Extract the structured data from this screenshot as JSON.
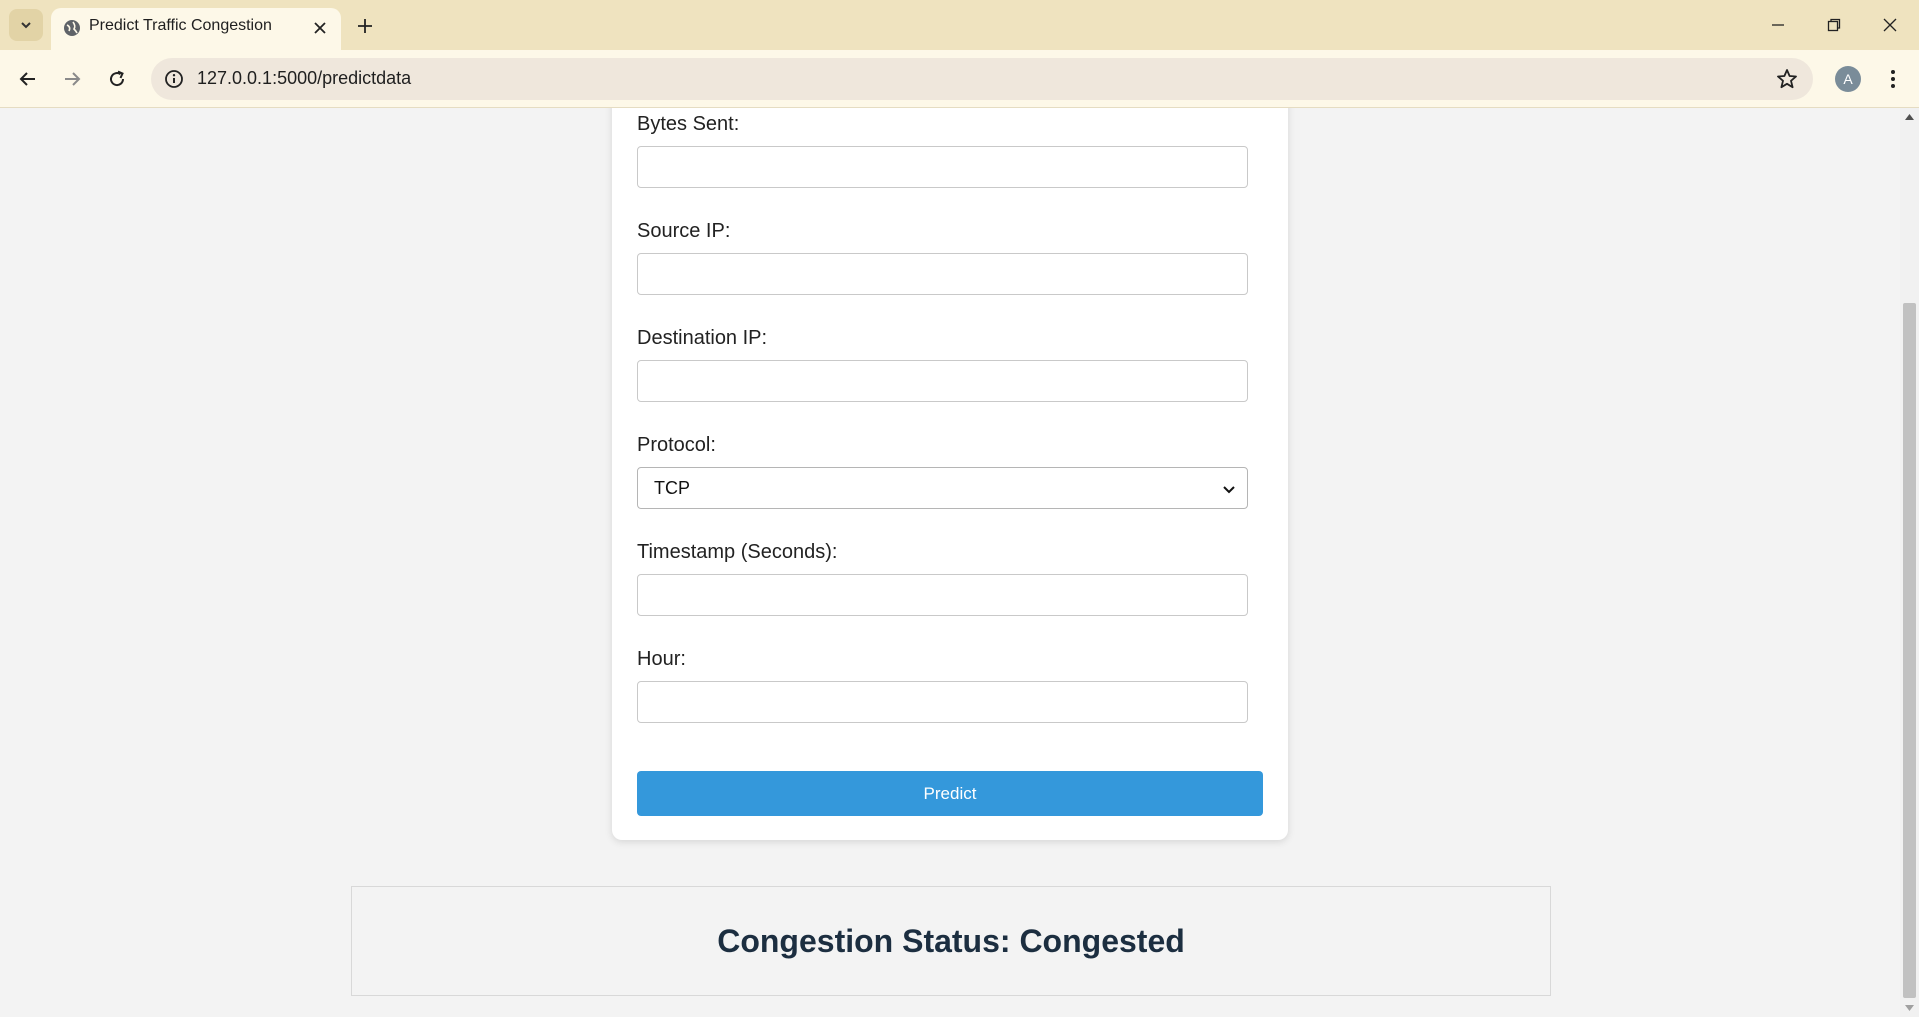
{
  "browser": {
    "tab_title": "Predict Traffic Congestion",
    "url": "127.0.0.1:5000/predictdata",
    "profile_initial": "A"
  },
  "form": {
    "fields": [
      {
        "label": "Bytes Sent:",
        "value": ""
      },
      {
        "label": "Source IP:",
        "value": ""
      },
      {
        "label": "Destination IP:",
        "value": ""
      },
      {
        "label": "Protocol:",
        "value": "TCP"
      },
      {
        "label": "Timestamp (Seconds):",
        "value": ""
      },
      {
        "label": "Hour:",
        "value": ""
      }
    ],
    "submit_label": "Predict"
  },
  "result": {
    "text": "Congestion Status: Congested"
  },
  "colors": {
    "accent": "#3498db",
    "tabstrip": "#efe3bf",
    "page_bg": "#f3f3f3",
    "result_text": "#1c2e40"
  },
  "icons": [
    "tab-search-icon",
    "globe-icon",
    "close-icon",
    "plus-icon",
    "minimize-icon",
    "restore-icon",
    "window-close-icon",
    "back-arrow-icon",
    "forward-arrow-icon",
    "reload-icon",
    "info-icon",
    "star-icon",
    "kebab-menu-icon",
    "chevron-down-icon"
  ]
}
